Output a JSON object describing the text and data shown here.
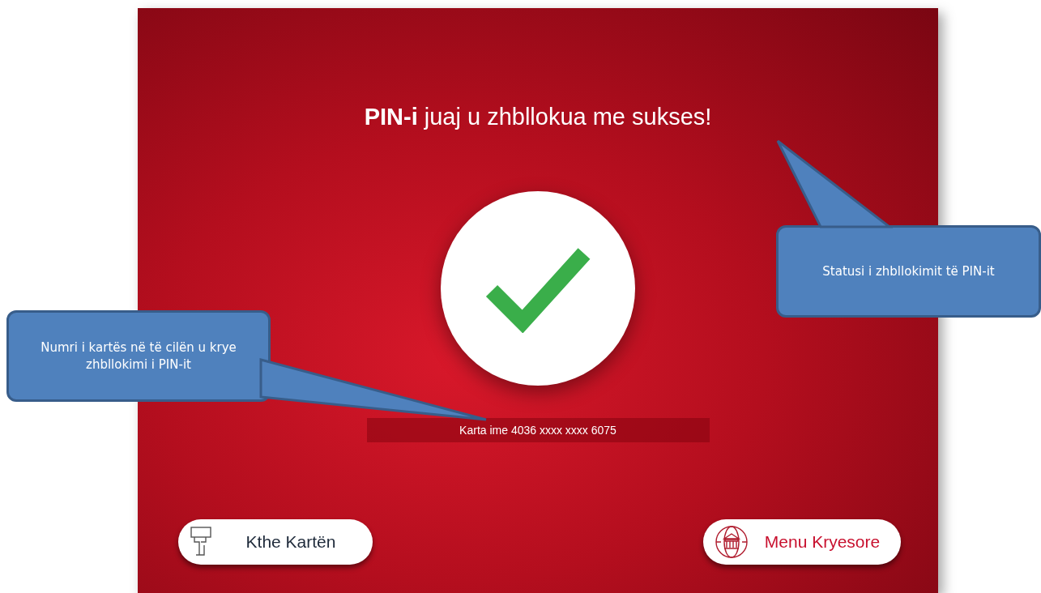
{
  "screen": {
    "title": "**PIN-i** juaj u zhbllokua me sukses!",
    "success": true,
    "card_info": "Karta ime 4036 xxxx xxxx 6075",
    "buttons": [
      {
        "kind": "card",
        "label": "Kthe Kartën"
      },
      {
        "kind": "menu",
        "label": "Menu Kryesore"
      }
    ]
  },
  "callouts": [
    {
      "kind": "status",
      "text": "Statusi i zhbllokimit të PIN-it"
    },
    {
      "kind": "card",
      "text": "Numri i kartës në të cilën u krye zhbllokimi i PIN-it"
    }
  ]
}
